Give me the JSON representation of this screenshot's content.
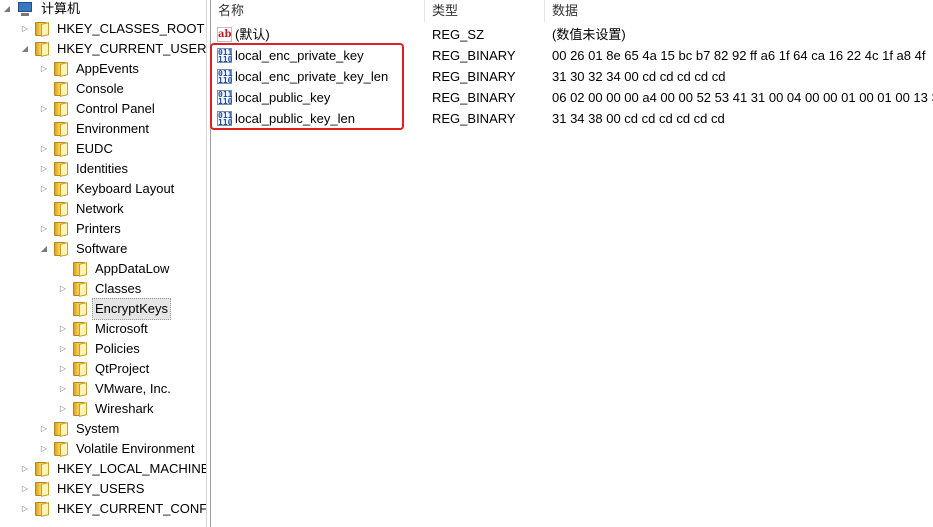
{
  "tree": {
    "root": "计算机",
    "nodes": [
      {
        "label": "HKEY_CLASSES_ROOT",
        "expander": "▷"
      },
      {
        "label": "HKEY_CURRENT_USER",
        "expander": "◢"
      },
      {
        "label": "AppEvents",
        "expander": "▷"
      },
      {
        "label": "Console",
        "expander": ""
      },
      {
        "label": "Control Panel",
        "expander": "▷"
      },
      {
        "label": "Environment",
        "expander": ""
      },
      {
        "label": "EUDC",
        "expander": "▷"
      },
      {
        "label": "Identities",
        "expander": "▷"
      },
      {
        "label": "Keyboard Layout",
        "expander": "▷"
      },
      {
        "label": "Network",
        "expander": ""
      },
      {
        "label": "Printers",
        "expander": "▷"
      },
      {
        "label": "Software",
        "expander": "◢"
      },
      {
        "label": "AppDataLow",
        "expander": ""
      },
      {
        "label": "Classes",
        "expander": "▷"
      },
      {
        "label": "EncryptKeys",
        "expander": ""
      },
      {
        "label": "Microsoft",
        "expander": "▷"
      },
      {
        "label": "Policies",
        "expander": "▷"
      },
      {
        "label": "QtProject",
        "expander": "▷"
      },
      {
        "label": "VMware, Inc.",
        "expander": "▷"
      },
      {
        "label": "Wireshark",
        "expander": "▷"
      },
      {
        "label": "System",
        "expander": "▷"
      },
      {
        "label": "Volatile Environment",
        "expander": "▷"
      },
      {
        "label": "HKEY_LOCAL_MACHINE",
        "expander": "▷"
      },
      {
        "label": "HKEY_USERS",
        "expander": "▷"
      },
      {
        "label": "HKEY_CURRENT_CONFIG",
        "expander": "▷"
      }
    ]
  },
  "list": {
    "headers": {
      "name": "名称",
      "type": "类型",
      "data": "数据"
    },
    "rows": [
      {
        "name": "(默认)",
        "type": "REG_SZ",
        "data": "(数值未设置)",
        "icon": "ab"
      },
      {
        "name": "local_enc_private_key",
        "type": "REG_BINARY",
        "data": "00 26 01 8e 65 4a 15 bc b7 82 92 ff a6 1f 64 ca 16 22 4c 1f a8 4f",
        "icon": "011"
      },
      {
        "name": "local_enc_private_key_len",
        "type": "REG_BINARY",
        "data": "31 30 32 34 00 cd cd cd cd cd",
        "icon": "011"
      },
      {
        "name": "local_public_key",
        "type": "REG_BINARY",
        "data": "06 02 00 00 00 a4 00 00 52 53 41 31 00 04 00 00 01 00 01 00 13 3",
        "icon": "011"
      },
      {
        "name": "local_public_key_len",
        "type": "REG_BINARY",
        "data": "31 34 38 00 cd cd cd cd cd cd",
        "icon": "011"
      }
    ]
  },
  "colors": {
    "highlight": "#e02020",
    "selection": "#e5e5e5"
  }
}
